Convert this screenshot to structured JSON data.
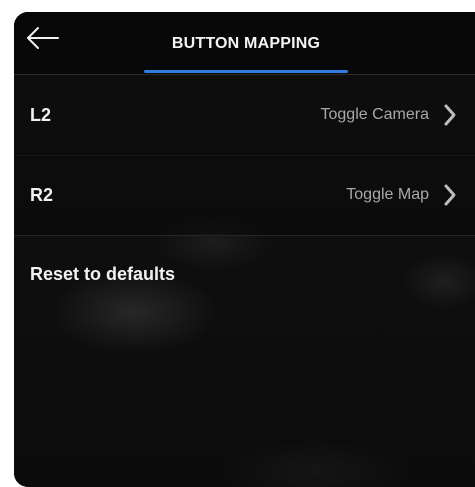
{
  "header": {
    "title": "BUTTON MAPPING",
    "back_icon": "arrow-left-icon",
    "accent_color": "#2f7fe0"
  },
  "mappings": [
    {
      "button": "L2",
      "action": "Toggle Camera",
      "icon": "chevron-right-icon"
    },
    {
      "button": "R2",
      "action": "Toggle Map",
      "icon": "chevron-right-icon"
    }
  ],
  "reset": {
    "label": "Reset to defaults"
  }
}
